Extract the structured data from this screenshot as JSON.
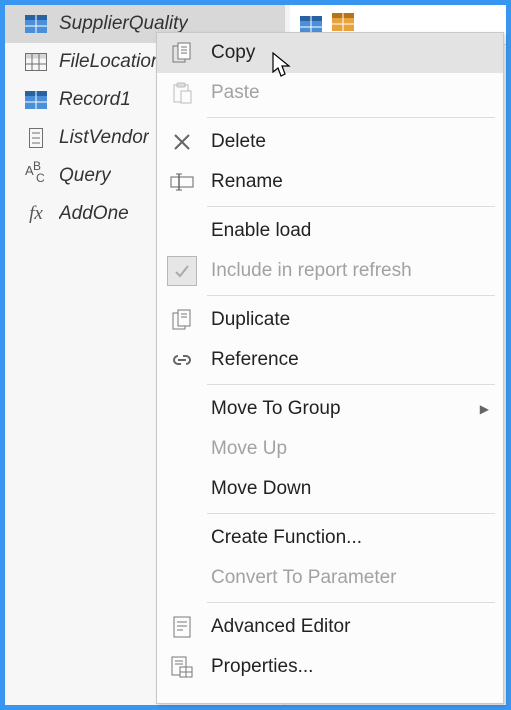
{
  "queries": [
    {
      "label": "SupplierQuality",
      "icon": "table-icon-blue",
      "selected": true
    },
    {
      "label": "FileLocation",
      "icon": "table-icon-outline",
      "selected": false
    },
    {
      "label": "Record1",
      "icon": "table-icon-blue",
      "selected": false
    },
    {
      "label": "ListVendor",
      "icon": "list-icon",
      "selected": false
    },
    {
      "label": "Query",
      "icon": "abc-icon",
      "selected": false
    },
    {
      "label": "AddOne",
      "icon": "fx-icon",
      "selected": false
    }
  ],
  "menu": {
    "copy": "Copy",
    "paste": "Paste",
    "delete": "Delete",
    "rename": "Rename",
    "enable_load": "Enable load",
    "include_refresh": "Include in report refresh",
    "duplicate": "Duplicate",
    "reference": "Reference",
    "move_to_group": "Move To Group",
    "move_up": "Move Up",
    "move_down": "Move Down",
    "create_function": "Create Function...",
    "convert_param": "Convert To Parameter",
    "advanced_editor": "Advanced Editor",
    "properties": "Properties..."
  }
}
